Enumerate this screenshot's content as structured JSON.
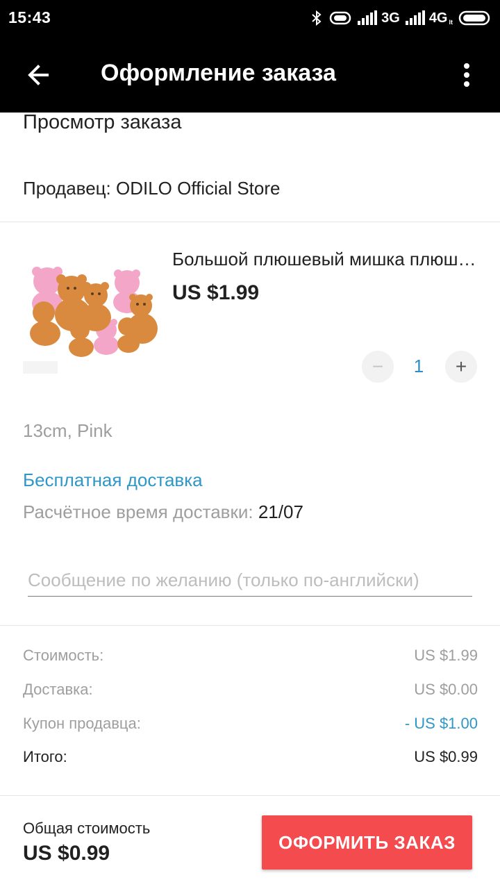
{
  "status_bar": {
    "time": "15:43",
    "network_1": "3G",
    "network_2": "4G",
    "network_2_suffix": "lt"
  },
  "app_bar": {
    "title": "Оформление заказа",
    "back_icon": "arrow-back-icon",
    "menu_icon": "more-vertical-icon"
  },
  "order_review": {
    "heading": "Просмотр заказа",
    "seller": "Продавец: ODILO Official Store"
  },
  "product": {
    "title": "Большой плюшевый мишка плюшевый медведь",
    "price": "US $1.99",
    "quantity": "1",
    "minus": "−",
    "plus": "+",
    "variant": "13cm, Pink"
  },
  "shipping": {
    "method": "Бесплатная доставка",
    "estimate_label": "Расчётное время доставки: ",
    "estimate_date": "21/07"
  },
  "message": {
    "placeholder": "Сообщение по желанию (только по-английски)"
  },
  "summary": {
    "cost_label": "Стоимость:",
    "cost_value": "US $1.99",
    "shipping_label": "Доставка:",
    "shipping_value": "US $0.00",
    "coupon_label": "Купон продавца:",
    "coupon_value": "- US $1.00",
    "total_label": "Итого:",
    "total_value": "US $0.99"
  },
  "bottom": {
    "total_label": "Общая стоимость",
    "total_value": "US $0.99",
    "button_label": "ОФОРМИТЬ ЗАКАЗ"
  },
  "colors": {
    "accent_blue": "#2f97c7",
    "button_red": "#f44b4f",
    "bar_black": "#000000"
  }
}
